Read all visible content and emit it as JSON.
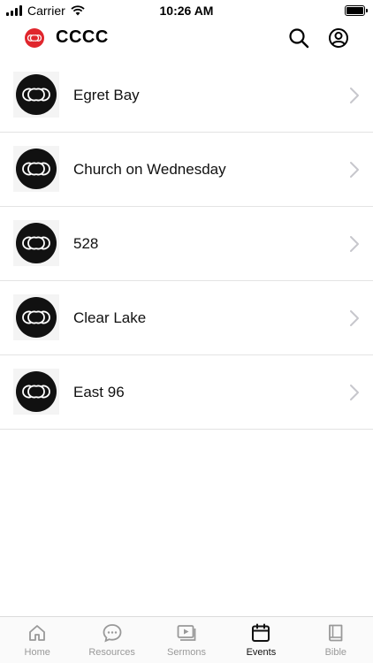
{
  "status_bar": {
    "carrier": "Carrier",
    "time": "10:26 AM"
  },
  "header": {
    "title": "CCCC"
  },
  "events": [
    {
      "label": "Egret Bay"
    },
    {
      "label": "Church on Wednesday"
    },
    {
      "label": "528"
    },
    {
      "label": "Clear Lake"
    },
    {
      "label": "East 96"
    }
  ],
  "tabs": [
    {
      "label": "Home",
      "icon": "home-icon"
    },
    {
      "label": "Resources",
      "icon": "chat-bubble-icon"
    },
    {
      "label": "Sermons",
      "icon": "video-play-icon"
    },
    {
      "label": "Events",
      "icon": "calendar-icon",
      "active": true
    },
    {
      "label": "Bible",
      "icon": "book-icon"
    }
  ],
  "colors": {
    "brand": "#e0262d",
    "thumb_bg": "#111111",
    "tab_inactive": "#999999",
    "tab_active": "#111111",
    "chevron": "#c7c7cc"
  }
}
